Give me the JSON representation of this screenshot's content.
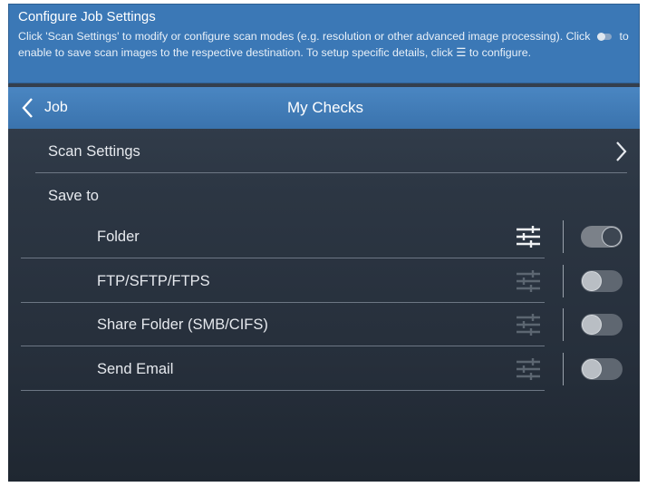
{
  "banner": {
    "title": "Configure Job Settings",
    "text1": "Click 'Scan Settings' to modify or configure scan modes (e.g. resolution or other advanced image processing).  Click",
    "text2": "to enable to save scan images to the respective destination. To setup specific details, click",
    "text3": "to configure."
  },
  "nav": {
    "back_label": "Job",
    "title": "My Checks"
  },
  "scan_settings": "Scan Settings",
  "save_to": "Save to",
  "destinations": [
    {
      "label": "Folder",
      "enabled": true
    },
    {
      "label": "FTP/SFTP/FTPS",
      "enabled": false
    },
    {
      "label": "Share Folder (SMB/CIFS)",
      "enabled": false
    },
    {
      "label": "Send Email",
      "enabled": false
    }
  ]
}
